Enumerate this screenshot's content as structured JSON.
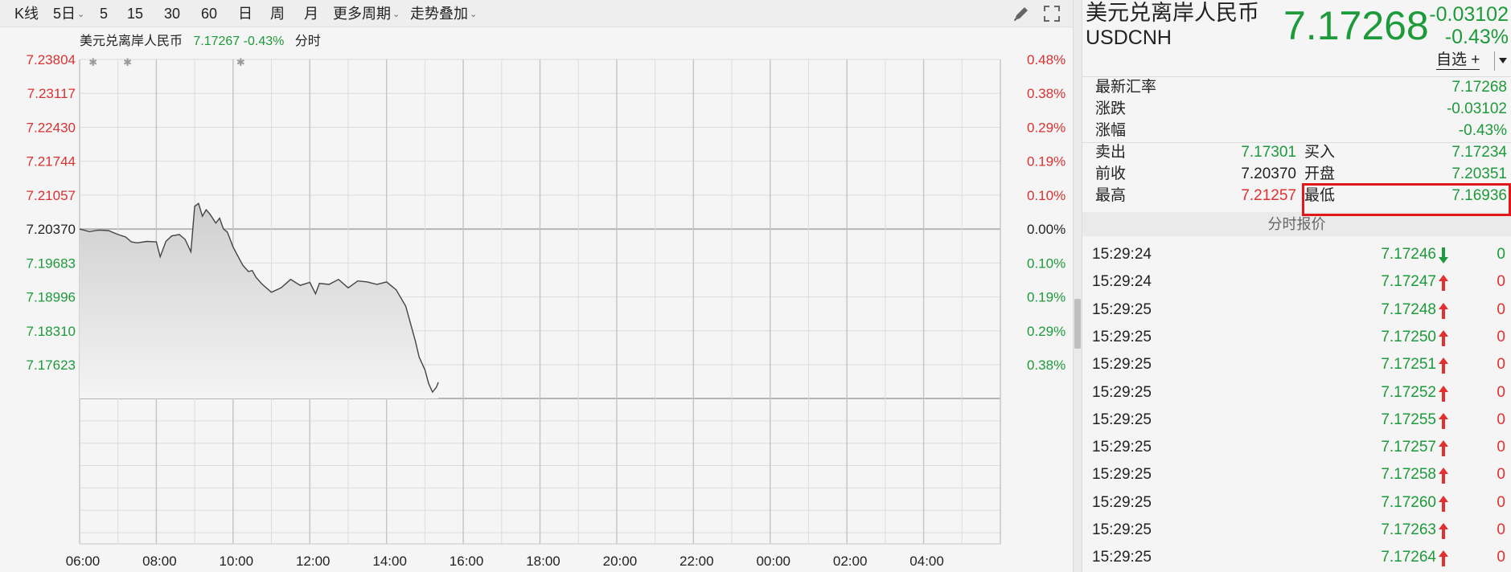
{
  "toolbar": {
    "items": [
      {
        "label": "K线",
        "dropdown": false
      },
      {
        "label": "5日",
        "dropdown": true
      },
      {
        "label": "5",
        "dropdown": false
      },
      {
        "label": "15",
        "dropdown": false
      },
      {
        "label": "30",
        "dropdown": false
      },
      {
        "label": "60",
        "dropdown": false
      },
      {
        "label": "日",
        "dropdown": false
      },
      {
        "label": "周",
        "dropdown": false
      },
      {
        "label": "月",
        "dropdown": false
      },
      {
        "label": "更多周期",
        "dropdown": true
      },
      {
        "label": "走势叠加",
        "dropdown": true
      }
    ],
    "draw_icon": "pen-icon",
    "fullscreen_icon": "fullscreen-icon"
  },
  "legend": {
    "name": "美元兑离岸人民币",
    "price": "7.17267",
    "pct": "-0.43%",
    "mode": "分时"
  },
  "chart_data": {
    "type": "area",
    "title": "",
    "xlabel": "",
    "ylabel": "",
    "prev_close": 7.2037,
    "ylim": [
      7.1694,
      7.23804
    ],
    "y_ticks_left": [
      {
        "label": "7.23804",
        "color": "#d83232"
      },
      {
        "label": "7.23117",
        "color": "#d83232"
      },
      {
        "label": "7.22430",
        "color": "#d83232"
      },
      {
        "label": "7.21744",
        "color": "#d83232"
      },
      {
        "label": "7.21057",
        "color": "#d83232"
      },
      {
        "label": "7.20370",
        "color": "#222222"
      },
      {
        "label": "7.19683",
        "color": "#1d9a3a"
      },
      {
        "label": "7.18996",
        "color": "#1d9a3a"
      },
      {
        "label": "7.18310",
        "color": "#1d9a3a"
      },
      {
        "label": "7.17623",
        "color": "#1d9a3a"
      }
    ],
    "y_ticks_right": [
      "0.48%",
      "0.38%",
      "0.29%",
      "0.19%",
      "0.10%",
      "0.00%",
      "0.10%",
      "0.19%",
      "0.29%",
      "0.38%"
    ],
    "x_ticks": [
      "06:00",
      "08:00",
      "10:00",
      "12:00",
      "14:00",
      "16:00",
      "18:00",
      "20:00",
      "22:00",
      "00:00",
      "02:00",
      "04:00"
    ],
    "x_range_hours": [
      0,
      24
    ],
    "series": [
      {
        "x": [
          0.0,
          0.25,
          0.5,
          0.75,
          1.0,
          1.2,
          1.35,
          1.5,
          1.75,
          2.0,
          2.1,
          2.25,
          2.4,
          2.6,
          2.75,
          2.9,
          3.0,
          3.1,
          3.2,
          3.3,
          3.4,
          3.55,
          3.65,
          3.75,
          3.85,
          4.0,
          4.1,
          4.25,
          4.4,
          4.5,
          4.6,
          4.75,
          5.0,
          5.25,
          5.5,
          5.75,
          6.0,
          6.15,
          6.25,
          6.5,
          6.75,
          7.0,
          7.25,
          7.5,
          7.75,
          8.0,
          8.25,
          8.5,
          8.75,
          8.85,
          9.0,
          9.1,
          9.2,
          9.3,
          9.35
        ],
        "values": [
          7.2037,
          7.2032,
          7.2035,
          7.2034,
          7.2026,
          7.2021,
          7.2011,
          7.2009,
          7.2012,
          7.2011,
          7.1981,
          7.2012,
          7.2023,
          7.2026,
          7.2016,
          7.1991,
          7.2083,
          7.2089,
          7.2063,
          7.2076,
          7.2067,
          7.2049,
          7.2059,
          7.2037,
          7.2031,
          7.2001,
          7.1986,
          7.1964,
          7.1951,
          7.1953,
          7.1939,
          7.1926,
          7.1909,
          7.1918,
          7.1935,
          7.1923,
          7.1929,
          7.1906,
          7.1927,
          7.1925,
          7.1935,
          7.1918,
          7.1932,
          7.193,
          7.1925,
          7.193,
          7.1914,
          7.1881,
          7.1811,
          7.1778,
          7.1752,
          7.1724,
          7.1707,
          7.1717,
          7.1727
        ]
      }
    ],
    "markers_hours": [
      0.35,
      1.25,
      4.2
    ],
    "colors": {
      "line": "#444444",
      "area_top": "#cfcfcf",
      "area_bottom": "#f4f4f4",
      "up": "#d83232",
      "down": "#1d9a3a"
    }
  },
  "quote": {
    "name_cn": "美元兑离岸人民币",
    "code": "USDCNH",
    "price": "7.17268",
    "change": "-0.03102",
    "pct": "-0.43%",
    "favorite_label": "自选 +",
    "rows": [
      {
        "label": "最新汇率",
        "value": "7.17268"
      },
      {
        "label": "涨跌",
        "value": "-0.03102"
      },
      {
        "label": "涨幅",
        "value": "-0.43%"
      }
    ],
    "pairs": [
      {
        "l1": "卖出",
        "v1": "7.17301",
        "c1": "g",
        "l2": "买入",
        "v2": "7.17234",
        "c2": "g"
      },
      {
        "l1": "前收",
        "v1": "7.20370",
        "c1": "k",
        "l2": "开盘",
        "v2": "7.20351",
        "c2": "g"
      },
      {
        "l1": "最高",
        "v1": "7.21257",
        "c1": "r",
        "l2": "最低",
        "v2": "7.16936",
        "c2": "g"
      }
    ]
  },
  "ticks": {
    "header": "分时报价",
    "rows": [
      {
        "time": "15:29:24",
        "price": "7.17246",
        "dir": "down",
        "vol": "0"
      },
      {
        "time": "15:29:24",
        "price": "7.17247",
        "dir": "up",
        "vol": "0"
      },
      {
        "time": "15:29:25",
        "price": "7.17248",
        "dir": "up",
        "vol": "0"
      },
      {
        "time": "15:29:25",
        "price": "7.17250",
        "dir": "up",
        "vol": "0"
      },
      {
        "time": "15:29:25",
        "price": "7.17251",
        "dir": "up",
        "vol": "0"
      },
      {
        "time": "15:29:25",
        "price": "7.17252",
        "dir": "up",
        "vol": "0"
      },
      {
        "time": "15:29:25",
        "price": "7.17255",
        "dir": "up",
        "vol": "0"
      },
      {
        "time": "15:29:25",
        "price": "7.17257",
        "dir": "up",
        "vol": "0"
      },
      {
        "time": "15:29:25",
        "price": "7.17258",
        "dir": "up",
        "vol": "0"
      },
      {
        "time": "15:29:25",
        "price": "7.17260",
        "dir": "up",
        "vol": "0"
      },
      {
        "time": "15:29:25",
        "price": "7.17263",
        "dir": "up",
        "vol": "0"
      },
      {
        "time": "15:29:25",
        "price": "7.17264",
        "dir": "up",
        "vol": "0"
      }
    ]
  }
}
